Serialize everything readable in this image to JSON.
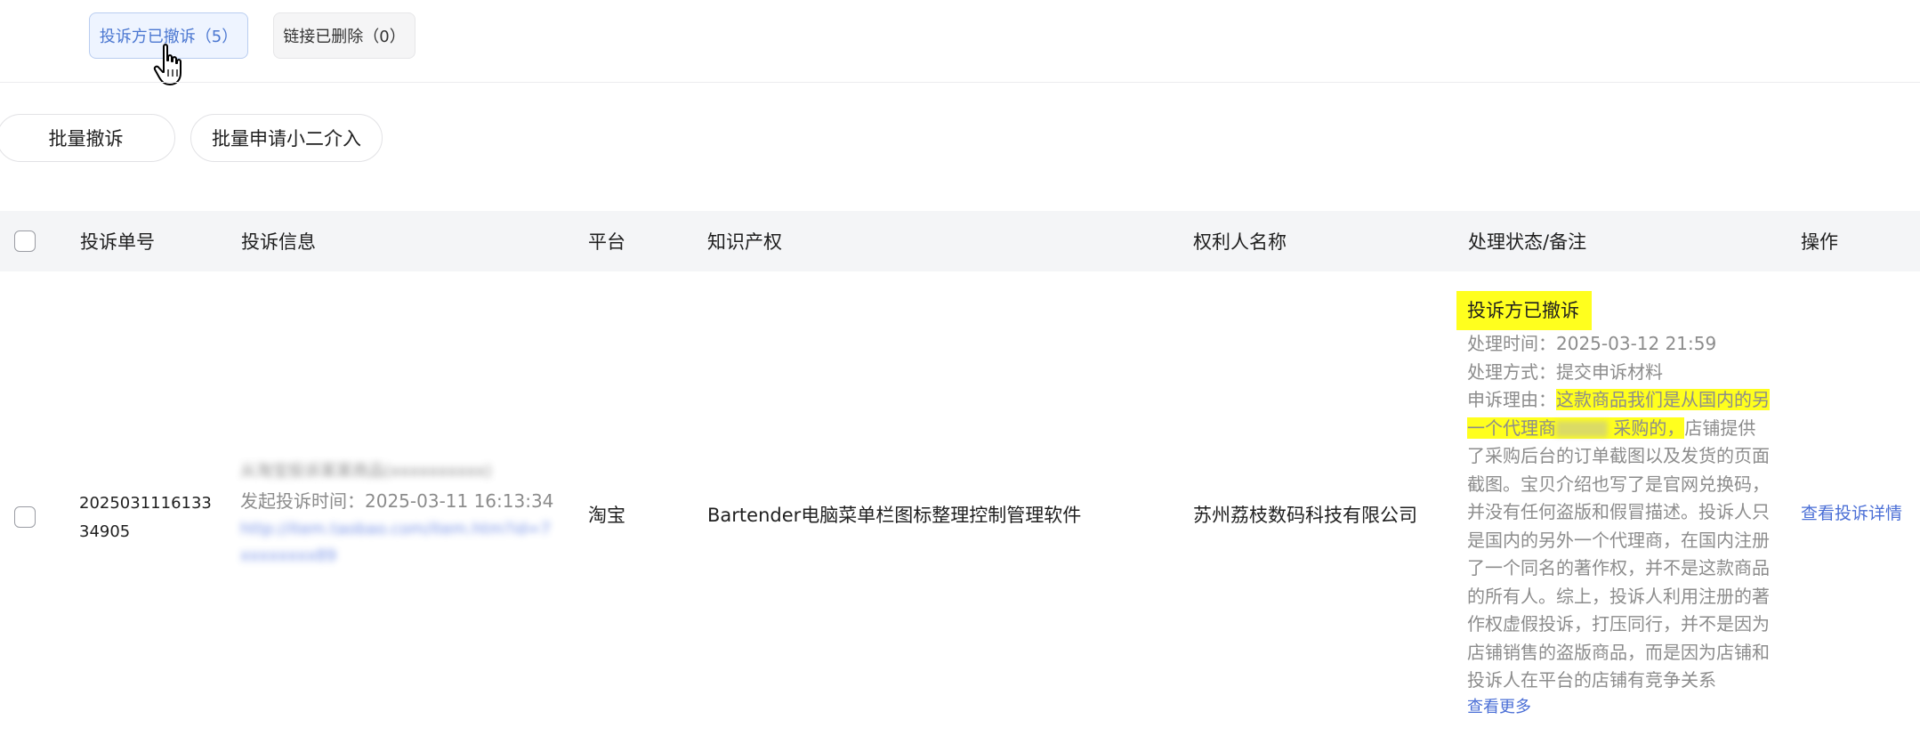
{
  "filters": {
    "withdrawn_label": "投诉方已撤诉（5）",
    "deleted_label": "链接已删除（0）"
  },
  "actions": {
    "batch_withdraw": "批量撤诉",
    "batch_intervene": "批量申请小二介入"
  },
  "table": {
    "headers": [
      "投诉单号",
      "投诉信息",
      "平台",
      "知识产权",
      "权利人名称",
      "处理状态/备注",
      "操作"
    ],
    "row": {
      "order_no": "202503111613334905",
      "info_blurred_line": "从淘宝投诉某某商品(xxxxxxxxxx)",
      "info_time": "发起投诉时间：2025-03-11 16:13:34",
      "info_link_blurred": "http://item.taobao.com/item.htm?id=7xxxxxxxx89",
      "platform": "淘宝",
      "ip": "Bartender电脑菜单栏图标整理控制管理软件",
      "owner": "苏州荔枝数码科技有限公司",
      "status": {
        "title": "投诉方已撤诉",
        "time": "处理时间：2025-03-12 21:59",
        "method": "处理方式：提交申诉材料",
        "reason_label": "申诉理由：",
        "reason_hl_1": "这款商品我们是从国内的另一个代理商",
        "reason_hl_2": "采购的，",
        "reason_rest": "店铺提供了采购后台的订单截图以及发货的页面截图。宝贝介绍也写了是官网兑换码，并没有任何盗版和假冒描述。投诉人只是国内的另外一个代理商，在国内注册了一个同名的著作权，并不是这款商品的所有人。综上，投诉人利用注册的著作权虚假投诉，打压同行，并不是因为店铺销售的盗版商品，而是因为店铺和投诉人在平台的店铺有竞争关系",
        "see_more": "查看更多"
      },
      "operation": "查看投诉详情"
    }
  },
  "colors": {
    "accent": "#4b6fd6",
    "highlight": "#ffff1e",
    "header_bg": "#f4f5f7"
  }
}
